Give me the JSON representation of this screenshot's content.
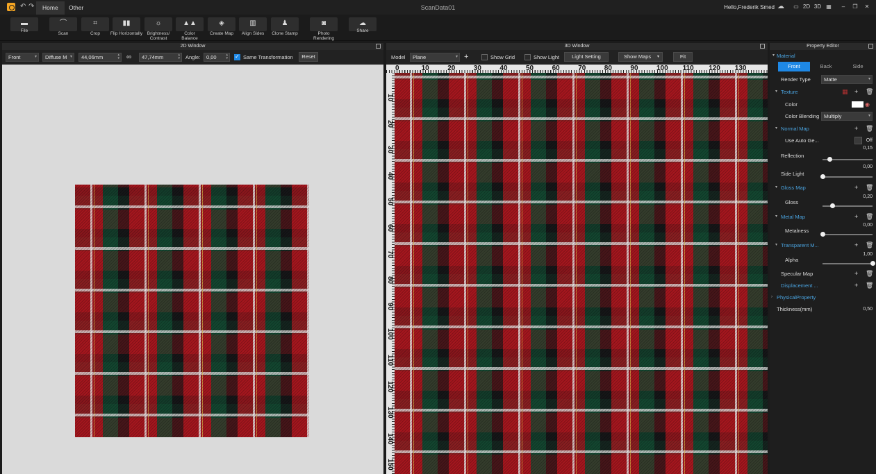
{
  "app": {
    "title": "ScanData01",
    "greeting": "Hello,Frederik Smed"
  },
  "tabs": [
    {
      "label": "Home"
    },
    {
      "label": "Other"
    }
  ],
  "titlebar_icons": {
    "cloud": "cloud-icon",
    "view_2d": "2D",
    "view_3d": "3D",
    "grid": "grid-icon"
  },
  "ribbon": [
    {
      "label": "File",
      "icon": "folder-icon"
    },
    {
      "label": "Scan",
      "icon": "scan-icon"
    },
    {
      "label": "Crop",
      "icon": "crop-icon"
    },
    {
      "label": "Flip Horizontally",
      "icon": "flip-icon"
    },
    {
      "label": "Brightness/ Contrast",
      "icon": "sun-icon"
    },
    {
      "label": "Color Balance",
      "icon": "balance-icon"
    },
    {
      "label": "Create Map",
      "icon": "map-icon"
    },
    {
      "label": "Align Sides",
      "icon": "align-icon"
    },
    {
      "label": "Clone Stamp",
      "icon": "stamp-icon"
    },
    {
      "label": "Photo Rendering",
      "icon": "camera-icon"
    },
    {
      "label": "Share",
      "icon": "share-cloud-icon"
    }
  ],
  "panel_2d": {
    "title": "2D Window",
    "side_select": "Front",
    "map_select": "Diffuse M",
    "width_value": "44,06mm",
    "height_value": "47,74mm",
    "angle_label": "Angle:",
    "angle_value": "0,00",
    "same_transformation_label": "Same Transformation",
    "same_transformation_checked": true,
    "reset_label": "Reset"
  },
  "panel_3d": {
    "title": "3D Window",
    "model_label": "Model",
    "model_value": "Plane",
    "show_grid_label": "Show Grid",
    "show_light_label": "Show Light",
    "light_setting_label": "Light Setting",
    "show_maps_label": "Show Maps",
    "fit_label": "Fit",
    "ruler_top": [
      "0",
      "10",
      "20",
      "30",
      "40",
      "50",
      "60",
      "70",
      "80",
      "90",
      "100",
      "110",
      "120",
      "130"
    ],
    "ruler_left": [
      "10",
      "20",
      "30",
      "40",
      "50",
      "60",
      "70",
      "80",
      "90",
      "100",
      "110",
      "120",
      "130",
      "140",
      "150"
    ]
  },
  "property_editor": {
    "title": "Property Editor",
    "material_label": "Material",
    "sides": [
      "Front",
      "Back",
      "Side"
    ],
    "active_side": "Front",
    "render_type_label": "Render Type",
    "render_type_value": "Matte",
    "texture_label": "Texture",
    "color_label": "Color",
    "color_swatch": "#ffffff",
    "color_blending_label": "Color Blending",
    "color_blending_value": "Multiply",
    "normal_map_label": "Normal Map",
    "use_auto_label": "Use Auto Ge...",
    "use_auto_state": "Off",
    "reflection_label": "Reflection",
    "reflection_value": "0,15",
    "reflection_fraction": 0.15,
    "side_light_label": "Side Light",
    "side_light_value": "0,00",
    "side_light_fraction": 0.0,
    "gloss_map_label": "Gloss Map",
    "gloss_label": "Gloss",
    "gloss_value": "0,20",
    "gloss_fraction": 0.2,
    "metal_map_label": "Metal Map",
    "metalness_label": "Metalness",
    "metalness_value": "0,00",
    "metalness_fraction": 0.0,
    "transparent_map_label": "Transparent M...",
    "alpha_label": "Alpha",
    "alpha_value": "1,00",
    "alpha_fraction": 1.0,
    "specular_map_label": "Specular Map",
    "displacement_label": "Displacement ...",
    "physical_property_label": "PhysicalProperty",
    "thickness_label": "Thickness(mm)",
    "thickness_value": "0,50"
  },
  "colors": {
    "accent": "#1e88e5",
    "section": "#4aa3df",
    "background": "#1b1b1b"
  }
}
